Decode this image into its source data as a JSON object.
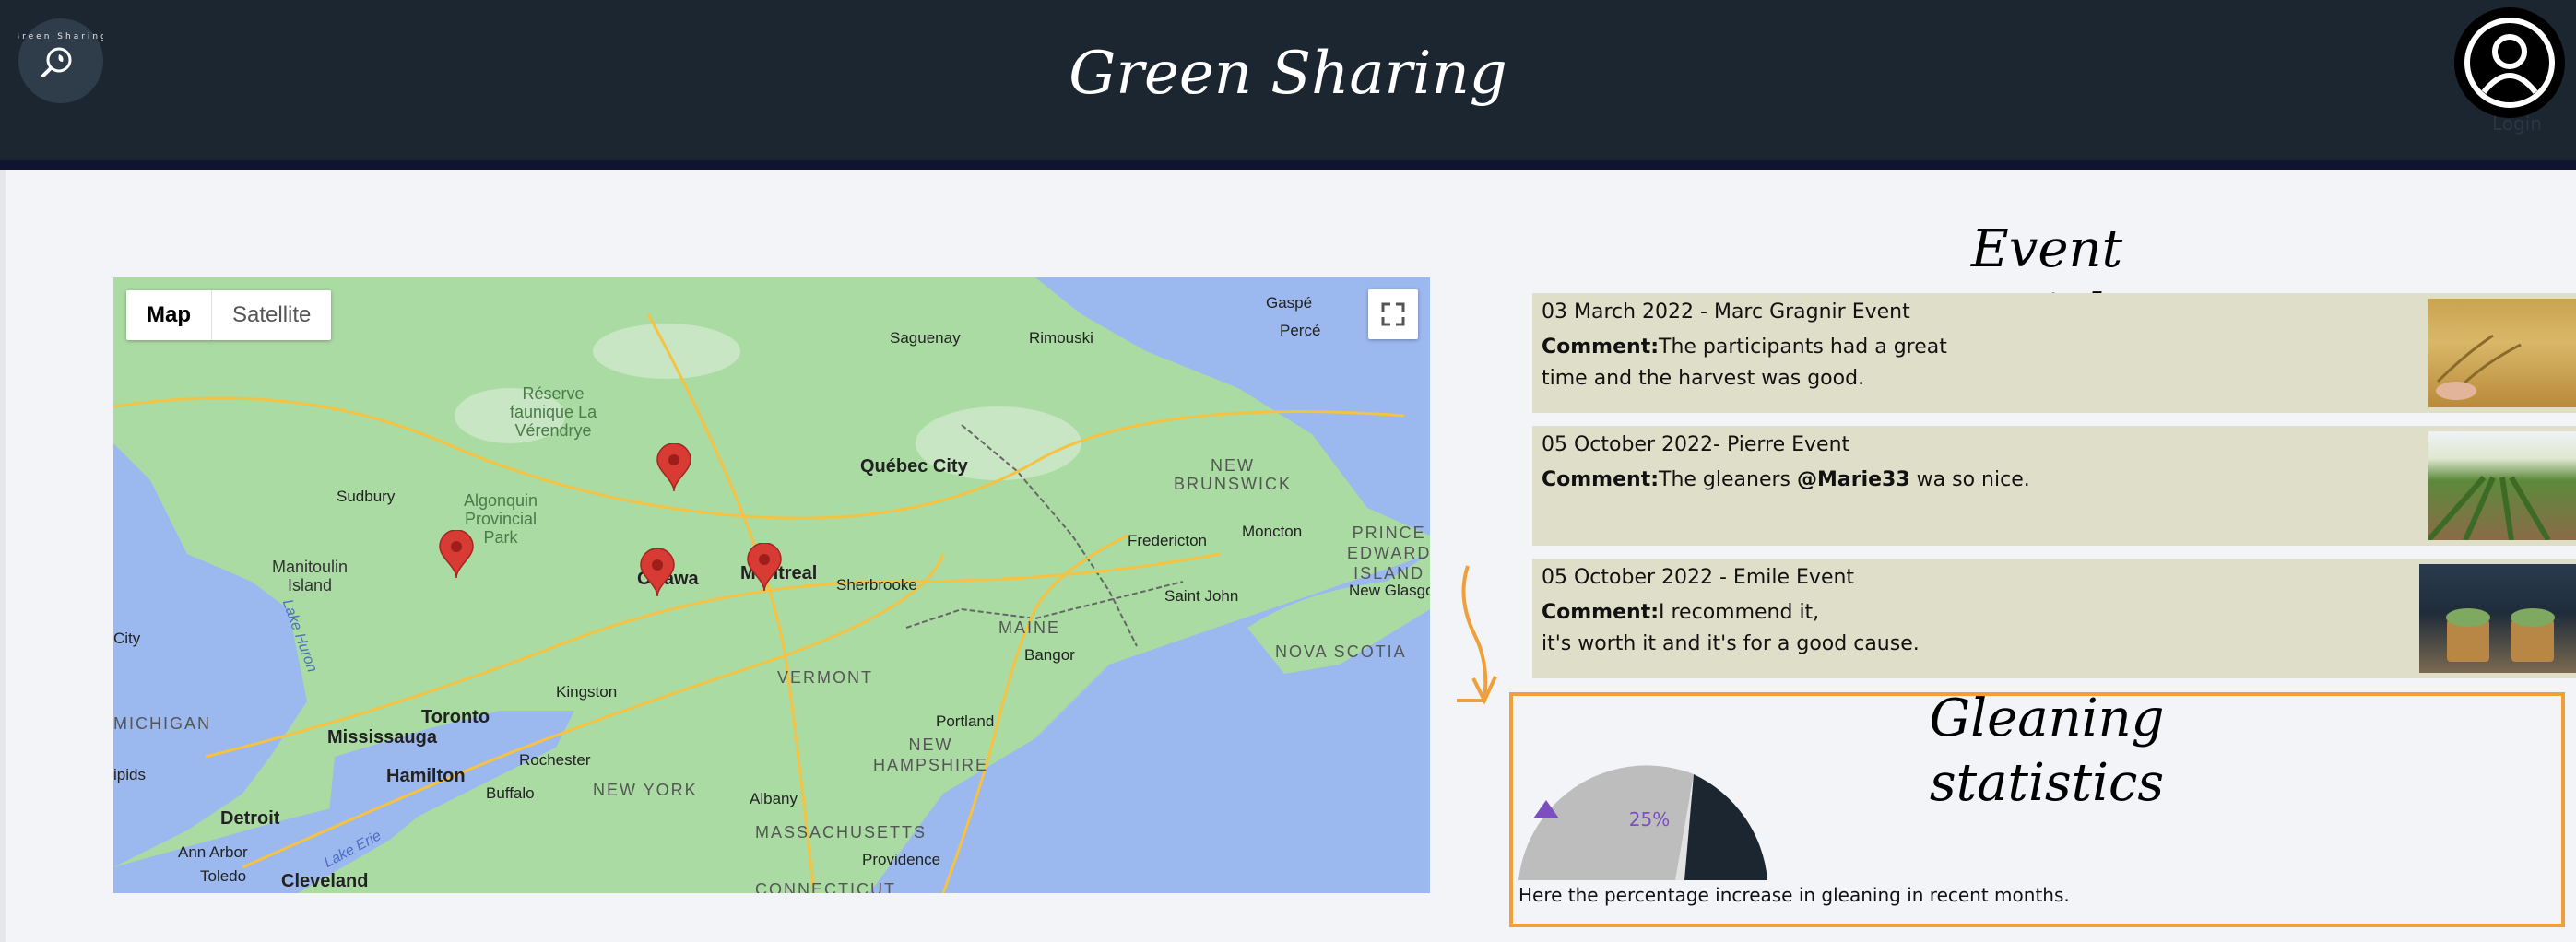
{
  "app": {
    "title": "Green Sharing",
    "logo_text": "Green Sharing",
    "login_label": "Login"
  },
  "map": {
    "type_buttons": [
      "Map",
      "Satellite"
    ],
    "labels": {
      "gaspe": "Gaspé",
      "perce": "Percé",
      "saguenay": "Saguenay",
      "rimouski": "Rimouski",
      "reserve": "Réserve\nfaunique La\nVérendrye",
      "quebec_city": "Québec City",
      "new_brunswick": "NEW\nBRUNSWICK",
      "sudbury": "Sudbury",
      "algonquin": "Algonquin\nProvincial\nPark",
      "manitoulin": "Manitoulin\nIsland",
      "ottawa": "Ottawa",
      "montreal": "Montreal",
      "sherbrooke": "Sherbrooke",
      "fredericton": "Fredericton",
      "moncton": "Moncton",
      "pei": "PRINCE\nEDWARD\nISLAND",
      "new_glasgow": "New Glasgow",
      "saint_john": "Saint John",
      "maine": "MAINE",
      "bangor": "Bangor",
      "nova_scotia": "NOVA SCOTIA",
      "city": "City",
      "lake_huron": "Lake Huron",
      "kingston": "Kingston",
      "vermont": "VERMONT",
      "michigan": "MICHIGAN",
      "toronto": "Toronto",
      "mississauga": "Mississauga",
      "rochester": "Rochester",
      "new_hampshire": "NEW\nHAMPSHIRE",
      "portland": "Portland",
      "hamilton": "Hamilton",
      "buffalo": "Buffalo",
      "new_york": "NEW YORK",
      "albany": "Albany",
      "ipids": "ipids",
      "detroit": "Detroit",
      "massachusetts": "MASSACHUSETTS",
      "lake_erie": "Lake Erie",
      "ann_arbor": "Ann Arbor",
      "providence": "Providence",
      "toledo": "Toledo",
      "cleveland": "Cleveland",
      "connecticut": "CONNECTICUT"
    }
  },
  "events": {
    "title": "Event Article",
    "items": [
      {
        "heading": "03 March 2022 - Marc Gragnir Event",
        "comment_label": "Comment:",
        "comment_a": "The participants had a great",
        "comment_b": "time and the harvest was good."
      },
      {
        "heading": "05 October 2022- Pierre Event",
        "comment_label": "Comment:",
        "comment_a": "The gleaners ",
        "mention": "@Marie33",
        "comment_c": " wa so nice."
      },
      {
        "heading": "05 October 2022 - Emile Event",
        "comment_label": "Comment:",
        "comment_a": "I recommend it,",
        "comment_b": "it's worth it and it's for a good cause."
      }
    ]
  },
  "stats": {
    "title": "Gleaning statistics",
    "percent_label": "25%",
    "caption": "Here the percentage increase in gleaning in recent months."
  },
  "colors": {
    "header": "#1b2631",
    "card": "#dfdfc9",
    "accent": "#f0a03a",
    "pin": "#d83a34"
  }
}
